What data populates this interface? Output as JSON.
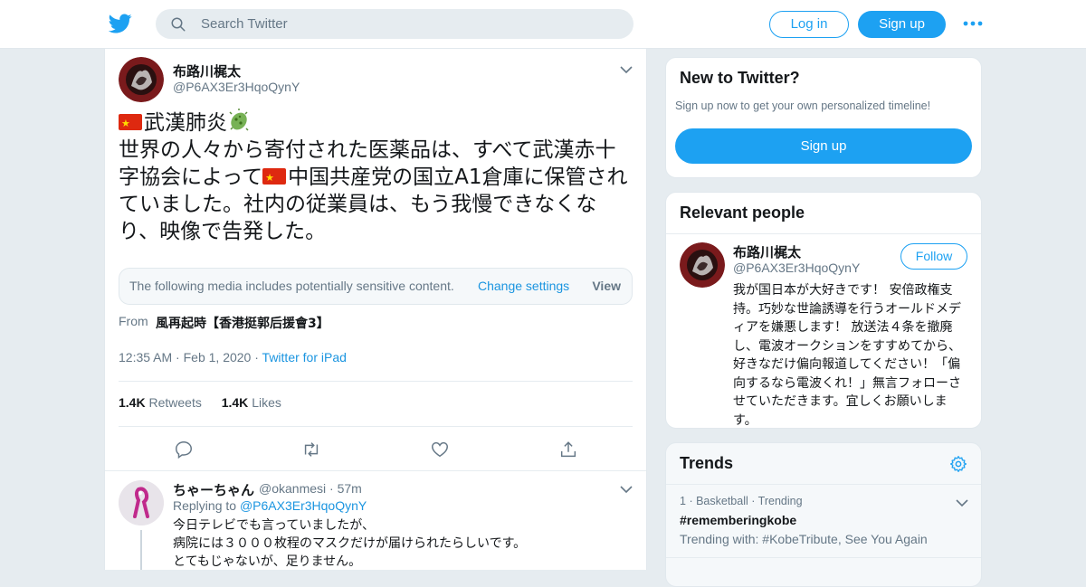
{
  "header": {
    "search_placeholder": "Search Twitter",
    "login_label": "Log in",
    "signup_label": "Sign up"
  },
  "tweet": {
    "author_name": "布路川梶太",
    "author_handle": "@P6AX3Er3HqoQynY",
    "text_line1": "武漢肺炎",
    "text_part2": "世界の人々から寄付された医薬品は、すべて武漢赤十字協会によって",
    "text_part3": "中国共産党の国立A1倉庫に保管されていました。社内の従業員は、もう我慢できなくなり、映像で告発した。",
    "sensitive_message": "The following media includes potentially sensitive content.",
    "change_settings": "Change settings",
    "view_label": "View",
    "from_label": "From",
    "from_name": "風再起時【香港挺郭后援會3】",
    "time": "12:35 AM",
    "date": "Feb 1, 2020",
    "source": "Twitter for iPad",
    "retweets_count": "1.4K",
    "retweets_label": "Retweets",
    "likes_count": "1.4K",
    "likes_label": "Likes"
  },
  "reply": {
    "name": "ちゃーちゃん",
    "handle": "@okanmesi",
    "time": "57m",
    "replying_label": "Replying to",
    "replying_to": "@P6AX3Er3HqoQynY",
    "lines": [
      "今日テレビでも言っていましたが、",
      "病院には３０００枚程のマスクだけが届けられたらしいです。",
      "とてもじゃないが、足りません。"
    ]
  },
  "sidebar": {
    "new_title": "New to Twitter?",
    "new_subtitle": "Sign up now to get your own personalized timeline!",
    "new_signup": "Sign up",
    "people_title": "Relevant people",
    "person_name": "布路川梶太",
    "person_handle": "@P6AX3Er3HqoQynY",
    "follow_label": "Follow",
    "person_bio": "我が国日本が大好きです！ 安倍政権支持。巧妙な世論誘導を行うオールドメディアを嫌悪します！ 放送法４条を撤廃し、電波オークションをすすめてから、好きなだけ偏向報道してください！「偏向するなら電波くれ！」無言フォローさせていただきます。宜しくお願いします。",
    "trends_title": "Trends",
    "trend_rank": "1",
    "trend_category": "Basketball",
    "trend_status": "Trending",
    "trend_tag": "#rememberingkobe",
    "trend_with": "Trending with: #KobeTribute, See You Again"
  },
  "colors": {
    "brand_blue": "#1da1f2",
    "link_blue": "#1b95e0",
    "muted": "#657786",
    "background": "#e6ecf0"
  },
  "icons": [
    "twitter-bird-icon",
    "search-icon",
    "more-icon",
    "chevron-down-icon",
    "reply-icon",
    "retweet-icon",
    "like-icon",
    "share-icon",
    "gear-icon",
    "flag-cn-icon",
    "virus-icon"
  ]
}
